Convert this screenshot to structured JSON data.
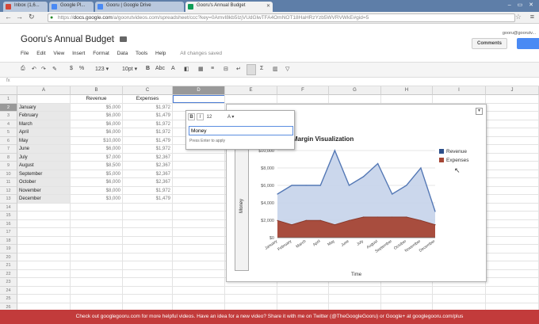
{
  "browser": {
    "tabs": [
      {
        "label": "Inbox (1,6...",
        "favicon_color": "#d44638",
        "active": false
      },
      {
        "label": "Google Pl...",
        "favicon_color": "#4a8af4",
        "active": false
      },
      {
        "label": "Gooru | Google Drive",
        "favicon_color": "#4a8af4",
        "active": false
      },
      {
        "label": "Gooru's Annual Budget",
        "favicon_color": "#0f9d58",
        "active": true
      }
    ],
    "url_prefix": "https://",
    "url_host": "docs.google.com",
    "url_path": "/a/goorutvideos.com/spreadsheet/ccc?key=0AmvI8kb5IzjVUdGlwTFA4OmNOT18HaHRzYzb5WVRVWkE#gid=5"
  },
  "doc": {
    "title": "Gooru's Annual Budget",
    "user_email": "gooru@goorutv...",
    "comments_label": "Comments",
    "menu": [
      "File",
      "Edit",
      "View",
      "Insert",
      "Format",
      "Data",
      "Tools",
      "Help"
    ],
    "save_status": "All changes saved"
  },
  "toolbar": {
    "format_123": "123 ▾",
    "font_size": "10pt ▾",
    "bold": "B",
    "abc": "Abc"
  },
  "formula_bar": {
    "label": "fx"
  },
  "sheet": {
    "columns": [
      "A",
      "B",
      "C",
      "D",
      "E",
      "F",
      "G",
      "H",
      "I",
      "J"
    ],
    "selected_column": "D",
    "selected_row": "2",
    "header_row": {
      "b": "Revenue",
      "c": "Expenses"
    },
    "rows": [
      {
        "month": "January",
        "revenue": "$5,000",
        "expenses": "$1,972"
      },
      {
        "month": "February",
        "revenue": "$6,000",
        "expenses": "$1,479"
      },
      {
        "month": "March",
        "revenue": "$6,000",
        "expenses": "$1,972"
      },
      {
        "month": "April",
        "revenue": "$6,000",
        "expenses": "$1,972"
      },
      {
        "month": "May",
        "revenue": "$10,000",
        "expenses": "$1,479"
      },
      {
        "month": "June",
        "revenue": "$6,000",
        "expenses": "$1,972"
      },
      {
        "month": "July",
        "revenue": "$7,000",
        "expenses": "$2,367"
      },
      {
        "month": "August",
        "revenue": "$8,500",
        "expenses": "$2,367"
      },
      {
        "month": "September",
        "revenue": "$5,000",
        "expenses": "$2,367"
      },
      {
        "month": "October",
        "revenue": "$6,000",
        "expenses": "$2,367"
      },
      {
        "month": "November",
        "revenue": "$8,000",
        "expenses": "$1,972"
      },
      {
        "month": "December",
        "revenue": "$3,000",
        "expenses": "$1,479"
      }
    ],
    "row_numbers": [
      "1",
      "2",
      "3",
      "4",
      "5",
      "6",
      "7",
      "8",
      "9",
      "10",
      "11",
      "12",
      "13",
      "14",
      "15",
      "16",
      "17",
      "18",
      "19",
      "20",
      "21",
      "22",
      "23",
      "24",
      "25",
      "26"
    ]
  },
  "editor": {
    "value": "Money",
    "hint": "Press Enter to apply",
    "size": "12"
  },
  "chart_data": {
    "type": "area",
    "title": "Margin Visualization",
    "xlabel": "Time",
    "ylabel": "Money",
    "categories": [
      "January",
      "February",
      "March",
      "April",
      "May",
      "June",
      "July",
      "August",
      "September",
      "October",
      "November",
      "December"
    ],
    "y_ticks": [
      "$0",
      "$2,000",
      "$4,000",
      "$6,000",
      "$8,000",
      "$10,000"
    ],
    "ylim": [
      0,
      10000
    ],
    "legend_position": "right",
    "series": [
      {
        "name": "Revenue",
        "color": "#c5d3ea",
        "line": "#5478b5",
        "values": [
          5000,
          6000,
          6000,
          6000,
          10000,
          6000,
          7000,
          8500,
          5000,
          6000,
          8000,
          3000
        ]
      },
      {
        "name": "Expenses",
        "color": "#a54635",
        "line": "#8a3a2c",
        "values": [
          1972,
          1479,
          1972,
          1972,
          1479,
          1972,
          2367,
          2367,
          2367,
          2367,
          1972,
          1479
        ]
      }
    ]
  },
  "footer": {
    "text": "Check out googlegooru.com for more helpful videos. Have an idea for a new video? Share it with me on Twitter (@TheGoogleGooru) or Google+ at googlegooru.com/plus"
  }
}
